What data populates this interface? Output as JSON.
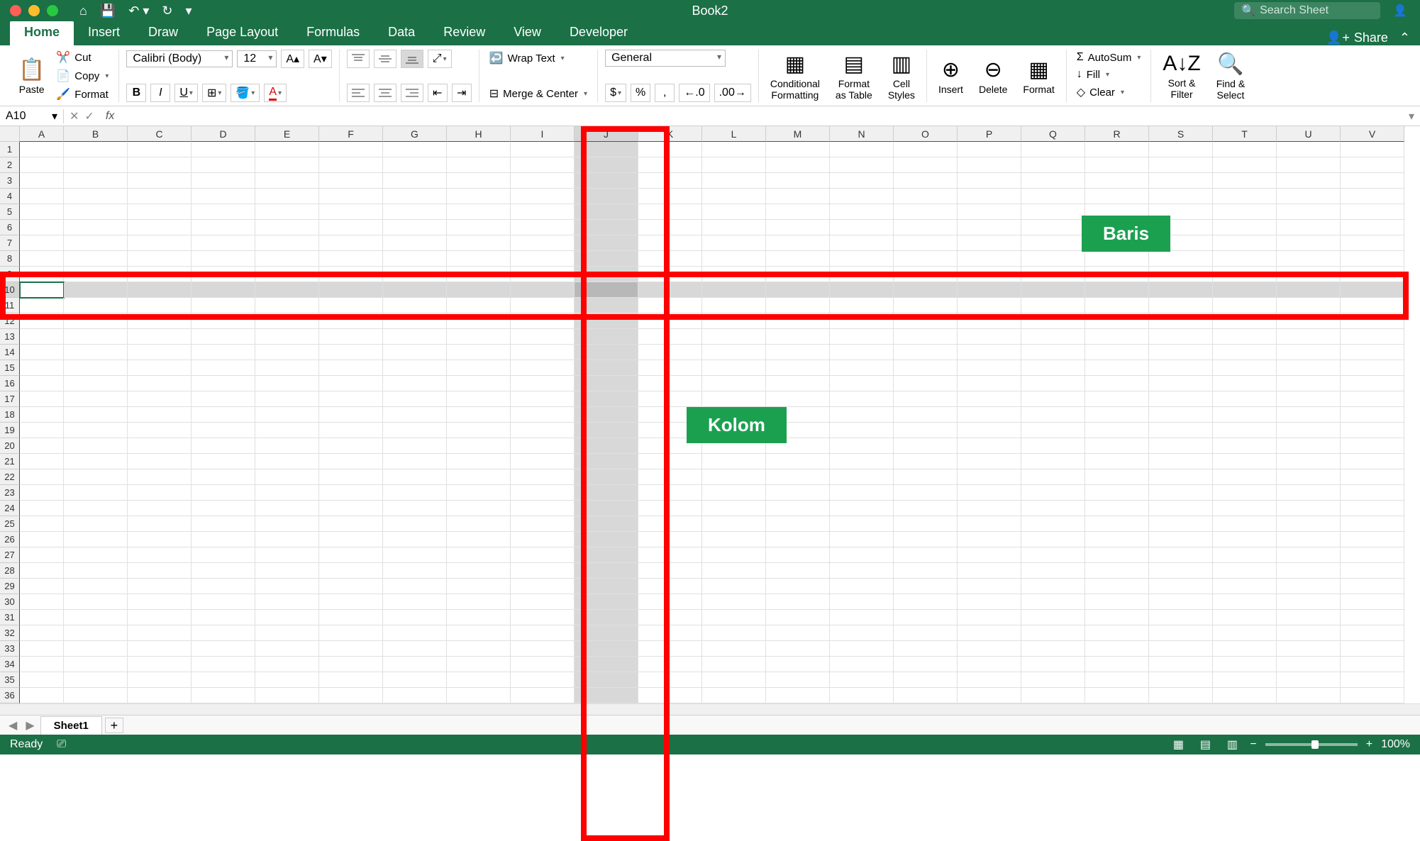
{
  "title": "Book2",
  "search_placeholder": "Search Sheet",
  "tabs": [
    "Home",
    "Insert",
    "Draw",
    "Page Layout",
    "Formulas",
    "Data",
    "Review",
    "View",
    "Developer"
  ],
  "active_tab": "Home",
  "share_label": "Share",
  "ribbon": {
    "paste": "Paste",
    "cut": "Cut",
    "copy": "Copy",
    "format_painter": "Format",
    "font_name": "Calibri (Body)",
    "font_size": "12",
    "wrap_text": "Wrap Text",
    "merge_center": "Merge & Center",
    "number_format": "General",
    "conditional_formatting": "Conditional\nFormatting",
    "format_as_table": "Format\nas Table",
    "cell_styles": "Cell\nStyles",
    "insert": "Insert",
    "delete": "Delete",
    "format": "Format",
    "autosum": "AutoSum",
    "fill": "Fill",
    "clear": "Clear",
    "sort_filter": "Sort &\nFilter",
    "find_select": "Find &\nSelect"
  },
  "name_box": "A10",
  "columns": [
    "A",
    "B",
    "C",
    "D",
    "E",
    "F",
    "G",
    "H",
    "I",
    "J",
    "K",
    "L",
    "M",
    "N",
    "O",
    "P",
    "Q",
    "R",
    "S",
    "T",
    "U",
    "V"
  ],
  "row_count": 36,
  "selected_row": 10,
  "selected_col": "J",
  "active_cell": "A10",
  "annotations": {
    "baris": "Baris",
    "kolom": "Kolom"
  },
  "sheet_tab": "Sheet1",
  "status": "Ready",
  "zoom": "100%"
}
